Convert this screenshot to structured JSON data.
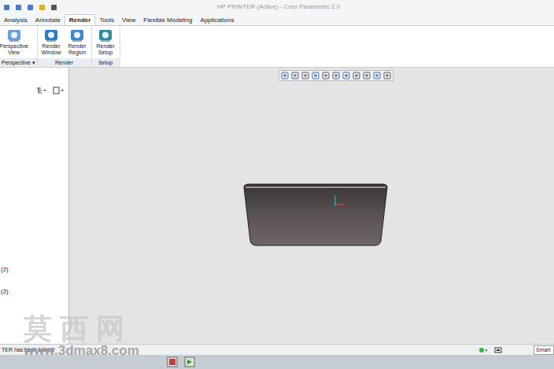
{
  "window": {
    "title": "HP PRINTER (Active) - Creo Parametric 2.0"
  },
  "tabs": [
    {
      "label": "Analysis",
      "selected": false
    },
    {
      "label": "Annotate",
      "selected": false
    },
    {
      "label": "Render",
      "selected": true
    },
    {
      "label": "Tools",
      "selected": false
    },
    {
      "label": "View",
      "selected": false
    },
    {
      "label": "Flexible Modeling",
      "selected": false
    },
    {
      "label": "Applications",
      "selected": false
    }
  ],
  "ribbon": {
    "groups": [
      {
        "label": "Perspective",
        "dropdown": "▾",
        "buttons": [
          {
            "lines": [
              "Perspective",
              "View"
            ]
          }
        ]
      },
      {
        "label": "Render",
        "dropdown": "",
        "buttons": [
          {
            "lines": [
              "Render",
              "Window"
            ]
          },
          {
            "lines": [
              "Render",
              "Region"
            ]
          }
        ]
      },
      {
        "label": "Setup",
        "dropdown": "",
        "buttons": [
          {
            "lines": [
              "Render",
              "Setup"
            ]
          }
        ]
      }
    ]
  },
  "model_tree": {
    "items": [
      {
        "label": "(2)"
      },
      {
        "label": "(2)"
      }
    ]
  },
  "status_bar": {
    "message": "TER has been saved.",
    "filter": "Smart"
  },
  "watermark": {
    "logo": "莫 西 网",
    "url": "www.3dmax8.com"
  }
}
